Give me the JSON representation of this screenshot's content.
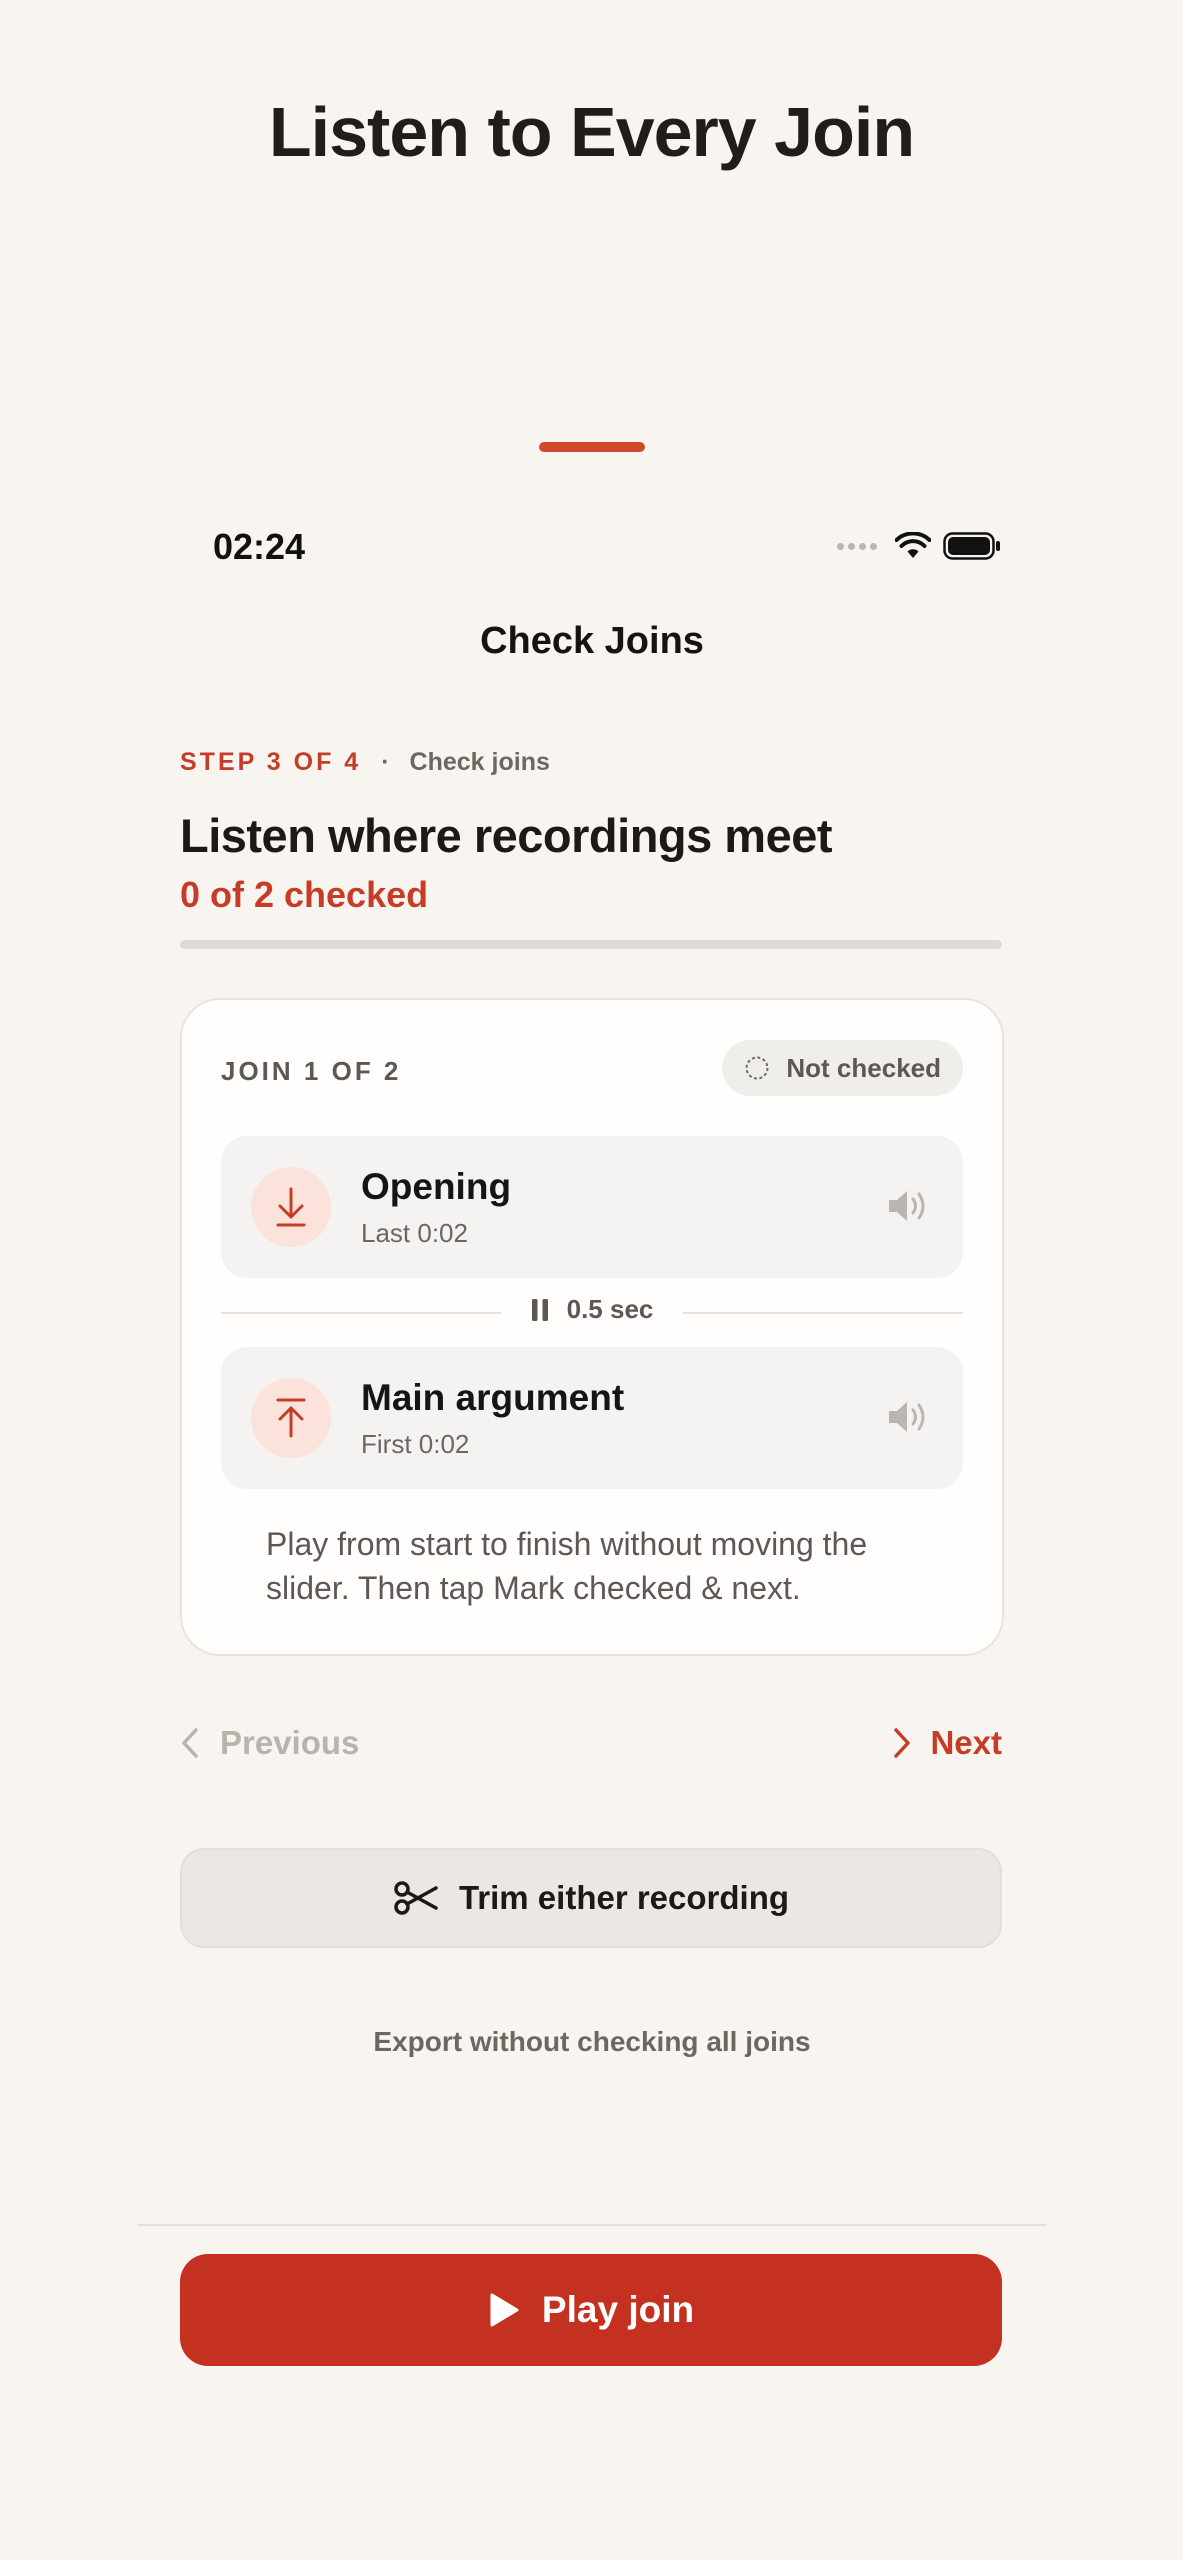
{
  "page": {
    "headline": "Listen to Every Join"
  },
  "status_bar": {
    "time": "02:24"
  },
  "nav": {
    "title": "Check Joins"
  },
  "step": {
    "label": "STEP 3 OF 4",
    "separator": "·",
    "name": "Check joins"
  },
  "header": {
    "heading": "Listen where recordings meet",
    "progress_text": "0 of 2 checked",
    "progress_fraction": 0
  },
  "join_card": {
    "label": "JOIN 1 OF 2",
    "status": "Not checked",
    "first_clip": {
      "title": "Opening",
      "subtitle": "Last 0:02",
      "icon": "arrow-down-icon"
    },
    "gap": {
      "label": "0.5 sec",
      "icon": "pause-icon"
    },
    "second_clip": {
      "title": "Main argument",
      "subtitle": "First 0:02",
      "icon": "arrow-up-icon"
    },
    "help_text": "Play from start to finish without moving the slider. Then tap Mark checked & next."
  },
  "navigation": {
    "previous_label": "Previous",
    "next_label": "Next"
  },
  "actions": {
    "trim_label": "Trim either recording",
    "export_label": "Export without checking all joins",
    "play_label": "Play join"
  },
  "colors": {
    "accent": "#c63d27",
    "play_button": "#c53120",
    "background": "#f8f5f0"
  }
}
